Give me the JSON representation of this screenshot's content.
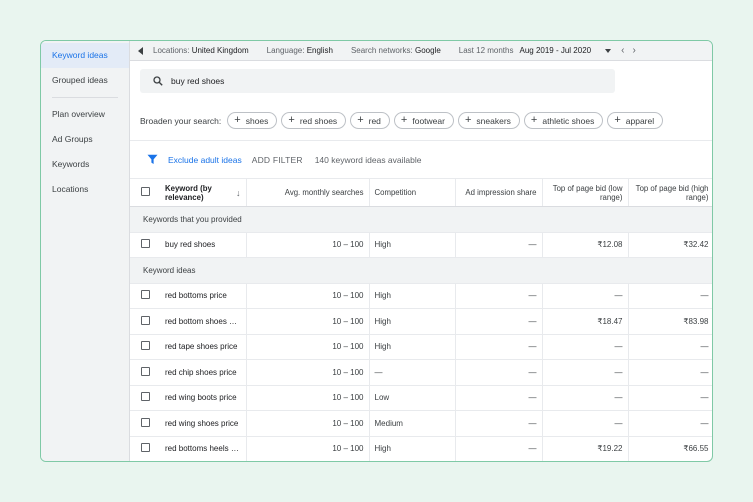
{
  "sidebar": {
    "items": [
      {
        "label": "Keyword ideas"
      },
      {
        "label": "Grouped ideas"
      },
      {
        "label": "Plan overview"
      },
      {
        "label": "Ad Groups"
      },
      {
        "label": "Keywords"
      },
      {
        "label": "Locations"
      }
    ]
  },
  "topbar": {
    "locations_label": "Locations:",
    "locations_value": "United Kingdom",
    "language_label": "Language:",
    "language_value": "English",
    "networks_label": "Search networks:",
    "networks_value": "Google",
    "period_label": "Last 12 months",
    "date_range": "Aug 2019 - Jul 2020"
  },
  "search": {
    "value": "buy red shoes"
  },
  "broaden": {
    "label": "Broaden your search:",
    "chips": [
      "shoes",
      "red shoes",
      "red",
      "footwear",
      "sneakers",
      "athletic shoes",
      "apparel"
    ]
  },
  "filters": {
    "exclude_label": "Exclude adult ideas",
    "add_filter": "ADD FILTER",
    "available": "140 keyword ideas available"
  },
  "table": {
    "headers": {
      "keyword": "Keyword (by relevance)",
      "searches": "Avg. monthly searches",
      "competition": "Competition",
      "impression": "Ad impression share",
      "bid_low": "Top of page bid (low range)",
      "bid_high": "Top of page bid (high range)"
    },
    "section_provided": "Keywords that you provided",
    "provided_rows": [
      {
        "keyword": "buy red shoes",
        "searches": "10 – 100",
        "competition": "High",
        "impression": "—",
        "bid_low": "₹12.08",
        "bid_high": "₹32.42"
      }
    ],
    "section_ideas": "Keyword ideas",
    "idea_rows": [
      {
        "keyword": "red bottoms price",
        "searches": "10 – 100",
        "competition": "High",
        "impression": "—",
        "bid_low": "—",
        "bid_high": "—"
      },
      {
        "keyword": "red bottom shoes pri...",
        "searches": "10 – 100",
        "competition": "High",
        "impression": "—",
        "bid_low": "₹18.47",
        "bid_high": "₹83.98"
      },
      {
        "keyword": "red tape shoes price",
        "searches": "10 – 100",
        "competition": "High",
        "impression": "—",
        "bid_low": "—",
        "bid_high": "—"
      },
      {
        "keyword": "red chip shoes price",
        "searches": "10 – 100",
        "competition": "—",
        "impression": "—",
        "bid_low": "—",
        "bid_high": "—"
      },
      {
        "keyword": "red wing boots price",
        "searches": "10 – 100",
        "competition": "Low",
        "impression": "—",
        "bid_low": "—",
        "bid_high": "—"
      },
      {
        "keyword": "red wing shoes price",
        "searches": "10 – 100",
        "competition": "Medium",
        "impression": "—",
        "bid_low": "—",
        "bid_high": "—"
      },
      {
        "keyword": "red bottoms heels pr...",
        "searches": "10 – 100",
        "competition": "High",
        "impression": "—",
        "bid_low": "₹19.22",
        "bid_high": "₹66.55"
      }
    ]
  },
  "colors": {
    "accent": "#1a73e8",
    "frame_border": "#7fc9a6",
    "page_bg": "#e9f5ef"
  }
}
